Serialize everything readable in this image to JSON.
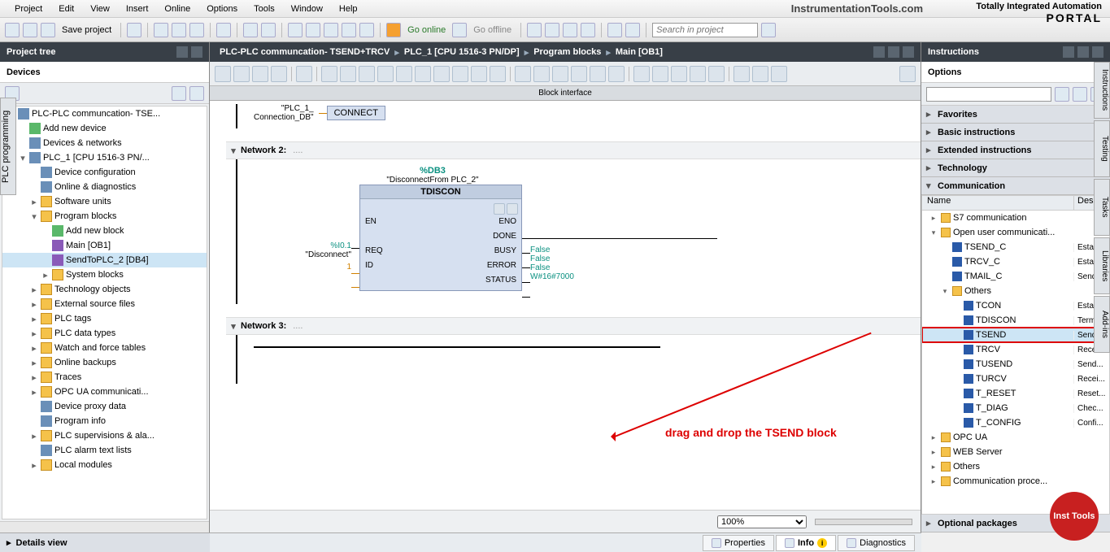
{
  "menu": [
    "Project",
    "Edit",
    "View",
    "Insert",
    "Online",
    "Options",
    "Tools",
    "Window",
    "Help"
  ],
  "brand": "InstrumentationTools.com",
  "portal": {
    "l1": "Totally Integrated Automation",
    "l2": "PORTAL"
  },
  "toolbar": {
    "save": "Save project",
    "go_online": "Go online",
    "go_offline": "Go offline",
    "search_ph": "Search in project"
  },
  "left": {
    "title": "Project tree",
    "tab": "Devices",
    "side_tab": "PLC programming",
    "tree": [
      {
        "d": 0,
        "e": "▾",
        "i": "dev",
        "t": "PLC-PLC communcation- TSE..."
      },
      {
        "d": 1,
        "e": "",
        "i": "add",
        "t": "Add new device"
      },
      {
        "d": 1,
        "e": "",
        "i": "dev",
        "t": "Devices & networks"
      },
      {
        "d": 1,
        "e": "▾",
        "i": "dev",
        "t": "PLC_1 [CPU 1516-3 PN/..."
      },
      {
        "d": 2,
        "e": "",
        "i": "dev",
        "t": "Device configuration"
      },
      {
        "d": 2,
        "e": "",
        "i": "dev",
        "t": "Online & diagnostics"
      },
      {
        "d": 2,
        "e": "▸",
        "i": "folder",
        "t": "Software units"
      },
      {
        "d": 2,
        "e": "▾",
        "i": "folder",
        "t": "Program blocks"
      },
      {
        "d": 3,
        "e": "",
        "i": "add",
        "t": "Add new block"
      },
      {
        "d": 3,
        "e": "",
        "i": "blk",
        "t": "Main [OB1]"
      },
      {
        "d": 3,
        "e": "",
        "i": "blk",
        "t": "SendToPLC_2 [DB4]",
        "sel": true
      },
      {
        "d": 3,
        "e": "▸",
        "i": "folder",
        "t": "System blocks"
      },
      {
        "d": 2,
        "e": "▸",
        "i": "folder",
        "t": "Technology objects"
      },
      {
        "d": 2,
        "e": "▸",
        "i": "folder",
        "t": "External source files"
      },
      {
        "d": 2,
        "e": "▸",
        "i": "folder",
        "t": "PLC tags"
      },
      {
        "d": 2,
        "e": "▸",
        "i": "folder",
        "t": "PLC data types"
      },
      {
        "d": 2,
        "e": "▸",
        "i": "folder",
        "t": "Watch and force tables"
      },
      {
        "d": 2,
        "e": "▸",
        "i": "folder",
        "t": "Online backups"
      },
      {
        "d": 2,
        "e": "▸",
        "i": "folder",
        "t": "Traces"
      },
      {
        "d": 2,
        "e": "▸",
        "i": "folder",
        "t": "OPC UA communicati..."
      },
      {
        "d": 2,
        "e": "",
        "i": "dev",
        "t": "Device proxy data"
      },
      {
        "d": 2,
        "e": "",
        "i": "dev",
        "t": "Program info"
      },
      {
        "d": 2,
        "e": "▸",
        "i": "folder",
        "t": "PLC supervisions & ala..."
      },
      {
        "d": 2,
        "e": "",
        "i": "dev",
        "t": "PLC alarm text lists"
      },
      {
        "d": 2,
        "e": "▸",
        "i": "folder",
        "t": "Local modules"
      }
    ],
    "details": "Details view"
  },
  "center": {
    "breadcrumb": [
      "PLC-PLC communcation- TSEND+TRCV",
      "PLC_1 [CPU 1516-3 PN/DP]",
      "Program blocks",
      "Main [OB1]"
    ],
    "block_iface": "Block interface",
    "net1": {
      "conn_lbl1": "\"PLC_1_",
      "conn_lbl2": "Connection_DB\"",
      "pin": "CONNECT"
    },
    "net2": {
      "title": "Network 2:",
      "db": "%DB3",
      "db_name": "\"DisconnectFrom PLC_2\"",
      "block_type": "TDISCON",
      "en": "EN",
      "eno": "ENO",
      "req": "REQ",
      "req_addr": "%I0.1",
      "req_sym": "\"Disconnect\"",
      "id": "ID",
      "id_val": "1",
      "done": "DONE",
      "done_v": "False",
      "busy": "BUSY",
      "busy_v": "False",
      "error": "ERROR",
      "error_v": "False",
      "status": "STATUS",
      "status_v": "W#16#7000"
    },
    "net3": {
      "title": "Network 3:"
    },
    "annotation": "drag and drop the TSEND block",
    "zoom": "100%",
    "tabs": {
      "props": "Properties",
      "info": "Info",
      "diag": "Diagnostics"
    }
  },
  "right": {
    "title": "Instructions",
    "options": "Options",
    "cats": {
      "fav": "Favorites",
      "basic": "Basic instructions",
      "ext": "Extended instructions",
      "tech": "Technology",
      "comm": "Communication",
      "opt": "Optional packages"
    },
    "cols": {
      "name": "Name",
      "desc": "Desc..."
    },
    "comm_tree": [
      {
        "d": 0,
        "e": "▸",
        "i": "folder",
        "t": "S7 communication",
        "v": ""
      },
      {
        "d": 0,
        "e": "▾",
        "i": "folder",
        "t": "Open user communicati...",
        "v": ""
      },
      {
        "d": 1,
        "e": "",
        "i": "instr",
        "t": "TSEND_C",
        "v": "Estab..."
      },
      {
        "d": 1,
        "e": "",
        "i": "instr",
        "t": "TRCV_C",
        "v": "Estab..."
      },
      {
        "d": 1,
        "e": "",
        "i": "instr",
        "t": "TMAIL_C",
        "v": "Send..."
      },
      {
        "d": 1,
        "e": "▾",
        "i": "folder",
        "t": "Others",
        "v": ""
      },
      {
        "d": 2,
        "e": "",
        "i": "instr",
        "t": "TCON",
        "v": "Estab..."
      },
      {
        "d": 2,
        "e": "",
        "i": "instr",
        "t": "TDISCON",
        "v": "Term..."
      },
      {
        "d": 2,
        "e": "",
        "i": "instr",
        "t": "TSEND",
        "v": "Send...",
        "hl": true,
        "sel": true
      },
      {
        "d": 2,
        "e": "",
        "i": "instr",
        "t": "TRCV",
        "v": "Recei..."
      },
      {
        "d": 2,
        "e": "",
        "i": "instr",
        "t": "TUSEND",
        "v": "Send..."
      },
      {
        "d": 2,
        "e": "",
        "i": "instr",
        "t": "TURCV",
        "v": "Recei..."
      },
      {
        "d": 2,
        "e": "",
        "i": "instr",
        "t": "T_RESET",
        "v": "Reset..."
      },
      {
        "d": 2,
        "e": "",
        "i": "instr",
        "t": "T_DIAG",
        "v": "Chec..."
      },
      {
        "d": 2,
        "e": "",
        "i": "instr",
        "t": "T_CONFIG",
        "v": "Confi..."
      },
      {
        "d": 0,
        "e": "▸",
        "i": "folder",
        "t": "OPC UA",
        "v": ""
      },
      {
        "d": 0,
        "e": "▸",
        "i": "folder",
        "t": "WEB Server",
        "v": ""
      },
      {
        "d": 0,
        "e": "▸",
        "i": "folder",
        "t": "Others",
        "v": ""
      },
      {
        "d": 0,
        "e": "▸",
        "i": "folder",
        "t": "Communication proce...",
        "v": ""
      }
    ],
    "side_tabs": [
      "Instructions",
      "Testing",
      "Tasks",
      "Libraries",
      "Add-ins"
    ]
  },
  "watermark": "Inst Tools"
}
